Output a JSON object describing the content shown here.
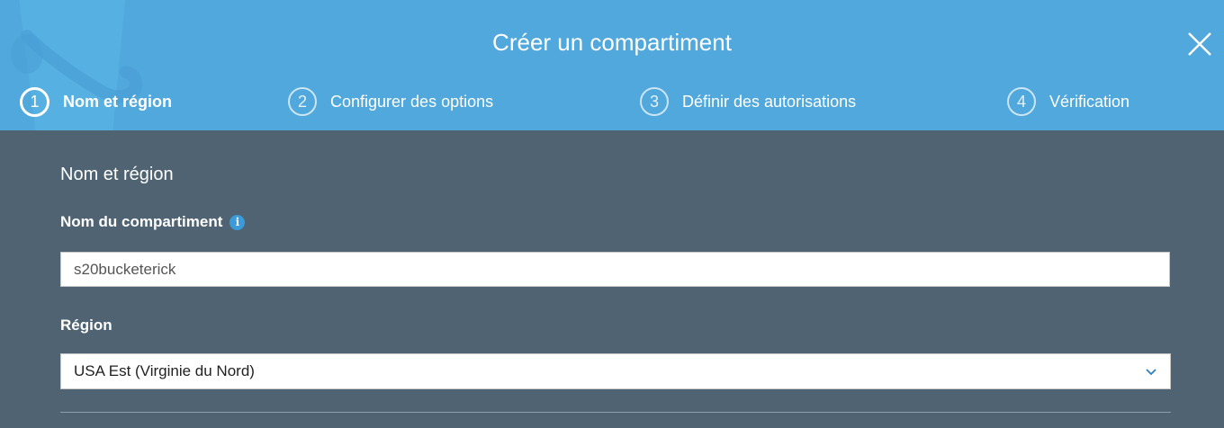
{
  "dialog": {
    "title": "Créer un compartiment",
    "close_icon": "close-icon"
  },
  "steps": [
    {
      "number": "1",
      "label": "Nom et région",
      "active": true
    },
    {
      "number": "2",
      "label": "Configurer des options",
      "active": false
    },
    {
      "number": "3",
      "label": "Définir des autorisations",
      "active": false
    },
    {
      "number": "4",
      "label": "Vérification",
      "active": false
    }
  ],
  "form": {
    "section_title": "Nom et région",
    "bucket_name": {
      "label": "Nom du compartiment",
      "info_icon": "info-icon",
      "value": "s20bucketerick"
    },
    "region": {
      "label": "Région",
      "selected": "USA Est (Virginie du Nord)",
      "icon": "chevron-down-icon"
    }
  },
  "colors": {
    "header_bg": "#50a8dc",
    "body_bg": "#4f6372",
    "info_icon": "#3b9ad9"
  }
}
